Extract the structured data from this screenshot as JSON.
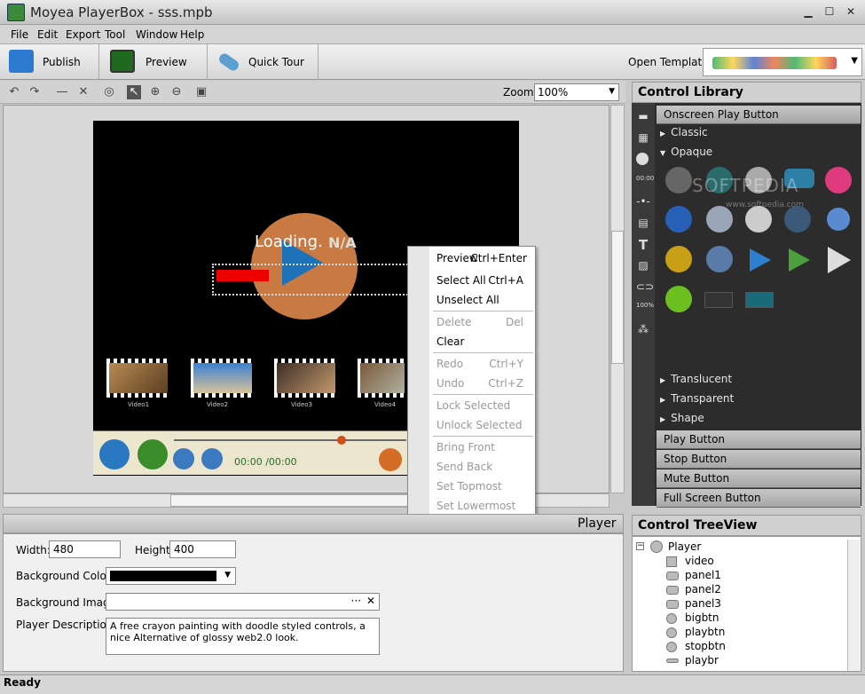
{
  "window": {
    "title": "Moyea PlayerBox - sss.mpb",
    "min": "▁",
    "max": "☐",
    "close": "✕"
  },
  "menu": [
    "File",
    "Edit",
    "Export",
    "Tool",
    "Window",
    "Help"
  ],
  "toolbar": {
    "publish": "Publish",
    "preview": "Preview",
    "quicktour": "Quick Tour",
    "open_template_label": "Open Template:"
  },
  "zoom": {
    "label": "Zoom:",
    "value": "100%"
  },
  "stage": {
    "loading": "Loading.",
    "na": "N/A",
    "time": "00:00 /00:00",
    "thumbs": [
      "Video1",
      "Video2",
      "Video3",
      "Video4"
    ]
  },
  "context_menu": [
    {
      "label": "Preview",
      "shortcut": "Ctrl+Enter",
      "disabled": false
    },
    {
      "label": "Select All",
      "shortcut": "Ctrl+A",
      "disabled": false
    },
    {
      "label": "Unselect All",
      "shortcut": "",
      "disabled": false
    },
    {
      "label": "Delete",
      "shortcut": "Del",
      "disabled": true
    },
    {
      "label": "Clear",
      "shortcut": "",
      "disabled": false
    },
    {
      "label": "Redo",
      "shortcut": "Ctrl+Y",
      "disabled": true
    },
    {
      "label": "Undo",
      "shortcut": "Ctrl+Z",
      "disabled": true
    },
    {
      "label": "Lock Selected",
      "shortcut": "",
      "disabled": true
    },
    {
      "label": "Unlock Selected",
      "shortcut": "",
      "disabled": true
    },
    {
      "label": "Bring Front",
      "shortcut": "",
      "disabled": true
    },
    {
      "label": "Send Back",
      "shortcut": "",
      "disabled": true
    },
    {
      "label": "Set Topmost",
      "shortcut": "",
      "disabled": true
    },
    {
      "label": "Set Lowermost",
      "shortcut": "",
      "disabled": true
    }
  ],
  "control_library": {
    "title": "Control Library",
    "top_section": "Onscreen Play Button",
    "tree_top": [
      "Classic",
      "Opaque"
    ],
    "tree_bottom": [
      "Translucent",
      "Transparent",
      "Shape"
    ],
    "sections": [
      "Play Button",
      "Stop Button",
      "Mute Button",
      "Full Screen Button"
    ],
    "watermark": "SOFTPEDIA",
    "watermark_url": "www.softpedia.com"
  },
  "properties": {
    "title": "Player",
    "width_label": "Width:",
    "width": "480",
    "height_label": "Height:",
    "height": "400",
    "bgcolor_label": "Background Color:",
    "bgimage_label": "Background Image:",
    "bgimage_dots": "···",
    "bgimage_clear": "✕",
    "desc_label": "Player Description:",
    "desc": "A free crayon painting with doodle styled controls, a nice Alternative of glossy web2.0 look."
  },
  "treeview": {
    "title": "Control TreeView",
    "root": "Player",
    "expander": "−",
    "items": [
      "video",
      "panel1",
      "panel2",
      "panel3",
      "bigbtn",
      "playbtn",
      "stopbtn",
      "playbr"
    ]
  },
  "status": "Ready"
}
